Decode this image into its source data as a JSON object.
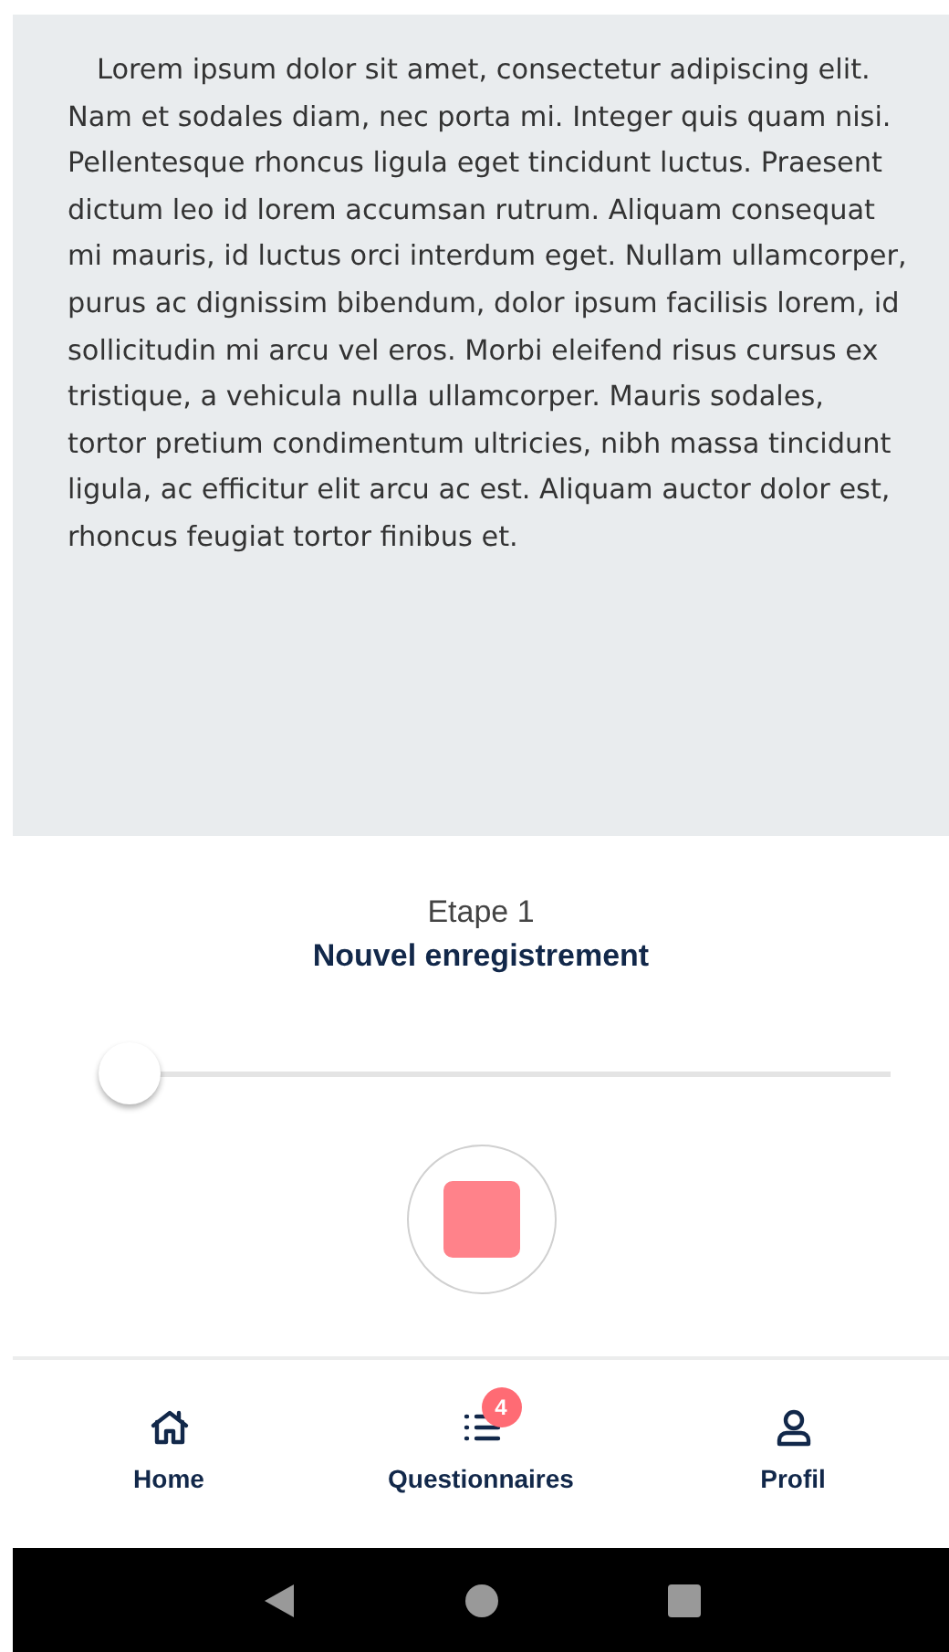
{
  "text_panel": {
    "paragraph": "Lorem ipsum dolor sit amet, consectetur adipiscing elit. Nam et sodales diam, nec porta mi. Integer quis quam nisi. Pellentesque rhoncus ligula eget tincidunt luctus. Praesent dictum leo id lorem accumsan rutrum. Aliquam consequat mi mauris, id luctus orci interdum eget. Nullam ullamcorper, purus ac dignissim bibendum, dolor ipsum facilisis lorem, id sollicitudin mi arcu vel eros. Morbi eleifend risus cursus ex tristique, a vehicula nulla ullamcorper. Mauris sodales, tortor pretium condimentum ultricies, nibh massa tincidunt ligula, ac efficitur elit arcu ac est. Aliquam auctor dolor est, rhoncus feugiat tortor finibus et."
  },
  "recorder": {
    "step": "Etape 1",
    "title": "Nouvel enregistrement",
    "progress": {
      "level": 0
    },
    "recording": true
  },
  "tabs": [
    {
      "kind": "home",
      "label": "Home",
      "selected": false
    },
    {
      "kind": "list",
      "label": "Questionnaires",
      "selected": false,
      "badge": "4"
    },
    {
      "kind": "user",
      "label": "Profil",
      "selected": false
    }
  ]
}
